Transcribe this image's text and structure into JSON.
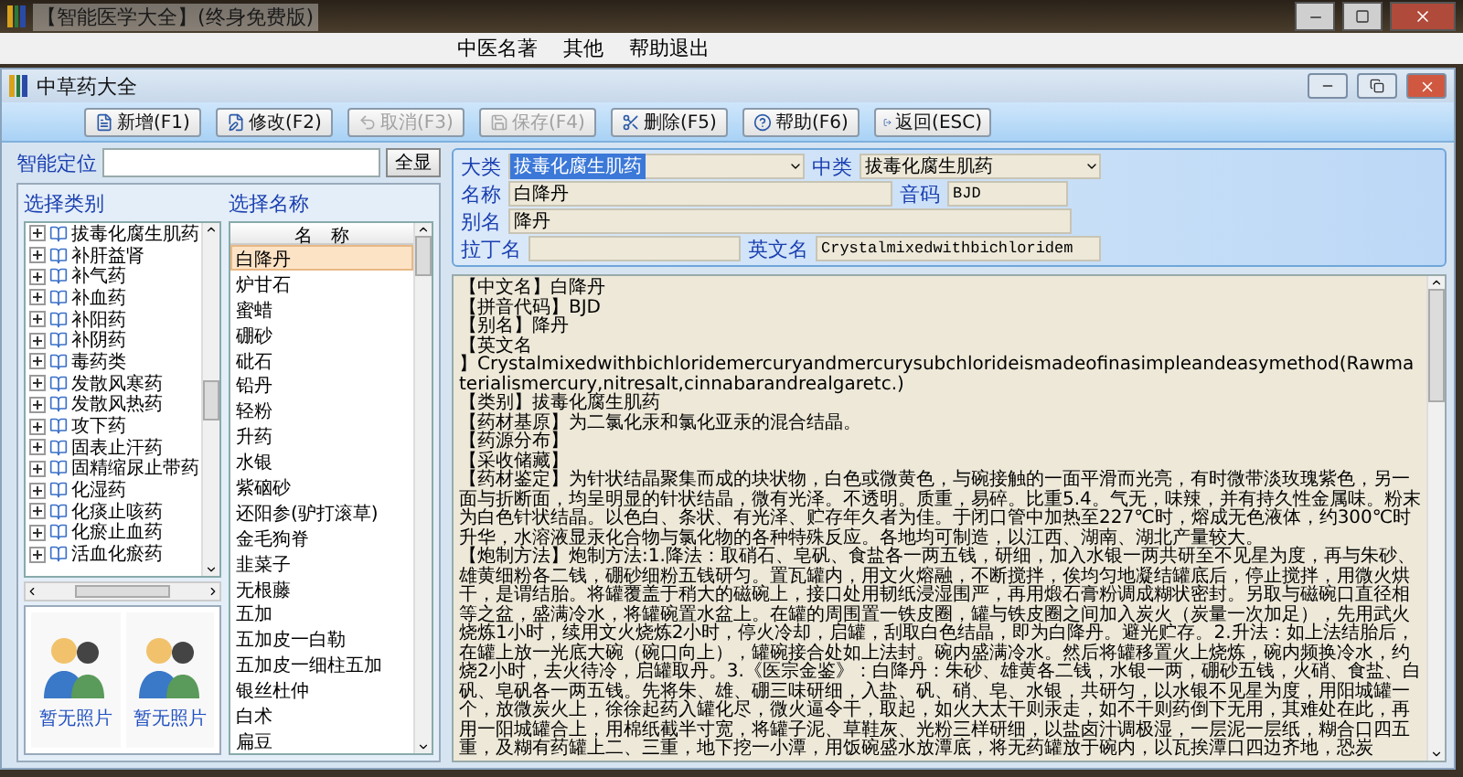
{
  "window": {
    "title": "【智能医学大全】(终身免费版)"
  },
  "menu": [
    "中医名著",
    "其他",
    "帮助退出"
  ],
  "child_window": {
    "title": "中草药大全"
  },
  "toolbar": [
    {
      "kind": "new",
      "label": "新增(F1)",
      "disabled": false
    },
    {
      "kind": "edit",
      "label": "修改(F2)",
      "disabled": false
    },
    {
      "kind": "cancel",
      "label": "取消(F3)",
      "disabled": true
    },
    {
      "kind": "save",
      "label": "保存(F4)",
      "disabled": true
    },
    {
      "kind": "delete",
      "label": "删除(F5)",
      "disabled": false
    },
    {
      "kind": "help",
      "label": "帮助(F6)",
      "disabled": false
    },
    {
      "kind": "back",
      "label": "返回(ESC)",
      "disabled": false
    }
  ],
  "search": {
    "label": "智能定位",
    "button": "全显"
  },
  "categories": {
    "label": "选择类别",
    "items": [
      {
        "text": "拔毒化腐生肌药",
        "expanded": false
      },
      {
        "text": "补肝益肾",
        "expanded": false
      },
      {
        "text": "补气药",
        "expanded": false
      },
      {
        "text": "补血药",
        "expanded": false
      },
      {
        "text": "补阳药",
        "expanded": false
      },
      {
        "text": "补阴药",
        "expanded": false
      },
      {
        "text": "毒药类",
        "expanded": false
      },
      {
        "text": "发散风寒药",
        "expanded": false
      },
      {
        "text": "发散风热药",
        "expanded": false
      },
      {
        "text": "攻下药",
        "expanded": false
      },
      {
        "text": "固表止汗药",
        "expanded": false
      },
      {
        "text": "固精缩尿止带药",
        "expanded": false
      },
      {
        "text": "化湿药",
        "expanded": false
      },
      {
        "text": "化痰止咳药",
        "expanded": false
      },
      {
        "text": "化瘀止血药",
        "expanded": false
      },
      {
        "text": "活血化瘀药",
        "expanded": false
      }
    ]
  },
  "names": {
    "label": "选择名称",
    "column": "名　称",
    "items": [
      {
        "text": "白降丹",
        "selected": true
      },
      {
        "text": "炉甘石",
        "selected": false
      },
      {
        "text": "蜜蜡",
        "selected": false
      },
      {
        "text": "硼砂",
        "selected": false
      },
      {
        "text": "砒石",
        "selected": false
      },
      {
        "text": "铅丹",
        "selected": false
      },
      {
        "text": "轻粉",
        "selected": false
      },
      {
        "text": "升药",
        "selected": false
      },
      {
        "text": "水银",
        "selected": false
      },
      {
        "text": "紫硇砂",
        "selected": false
      },
      {
        "text": "还阳参(驴打滚草)",
        "selected": false
      },
      {
        "text": "金毛狗脊",
        "selected": false
      },
      {
        "text": "韭菜子",
        "selected": false
      },
      {
        "text": "无根藤",
        "selected": false
      },
      {
        "text": "五加",
        "selected": false
      },
      {
        "text": "五加皮一白勒",
        "selected": false
      },
      {
        "text": "五加皮一细柱五加",
        "selected": false
      },
      {
        "text": "银丝杜仲",
        "selected": false
      },
      {
        "text": "白术",
        "selected": false
      },
      {
        "text": "扁豆",
        "selected": false
      }
    ]
  },
  "photos": [
    {
      "caption": "暂无照片"
    },
    {
      "caption": "暂无照片"
    }
  ],
  "form": {
    "major_class": {
      "label": "大类",
      "value": "拔毒化腐生肌药"
    },
    "mid_class": {
      "label": "中类",
      "value": "拔毒化腐生肌药"
    },
    "name": {
      "label": "名称",
      "value": "白降丹"
    },
    "code": {
      "label": "音码",
      "value": "BJD"
    },
    "alias": {
      "label": "别名",
      "value": "降丹"
    },
    "latin_name": {
      "label": "拉丁名"
    },
    "english_name": {
      "label": "英文名",
      "value": "Crystalmixedwithbichloridem"
    }
  },
  "details": [
    "【中文名】白降丹",
    "【拼音代码】BJD",
    "【别名】降丹",
    "【英文名",
    "】Crystalmixedwithbichloridemercuryandmercurysubchlorideismadeofinasimpleandeasymethod(Rawmaterialismercury,nitresalt,cinnabarandrealgaretc.)",
    "【类别】拔毒化腐生肌药",
    "【药材基原】为二氯化汞和氯化亚汞的混合结晶。",
    "【药源分布】",
    "【采收储藏】",
    "【药材鉴定】为针状结晶聚集而成的块状物，白色或微黄色，与碗接触的一面平滑而光亮，有时微带淡玫瑰紫色，另一面与折断面，均呈明显的针状结晶，微有光泽。不透明。质重，易碎。比重5.4。气无，味辣，并有持久性金属味。粉末为白色针状结晶。以色白、条状、有光泽、贮存年久者为佳。于闭口管中加热至227℃时，熔成无色液体，约300℃时升华，水溶液显汞化合物与氯化物的各种特殊反应。各地均可制造，以江西、湖南、湖北产量较大。",
    "【炮制方法】炮制方法:1.降法：取硝石、皂矾、食盐各一两五钱，研细，加入水银一两共研至不见星为度，再与朱砂、雄黄细粉各二钱，硼砂细粉五钱研匀。置瓦罐内，用文火熔融，不断搅拌，俟均匀地凝结罐底后，停止搅拌，用微火烘干，是谓结胎。将罐覆盖于稍大的磁碗上，接口处用韧纸浸湿围严，再用煅石膏粉调成糊状密封。另取与磁碗口直径相等之盆，盛满冷水，将罐碗置水盆上。在罐的周围置一铁皮圈，罐与铁皮圈之间加入炭火（炭量一次加足），先用武火烧炼1小时，续用文火烧炼2小时，停火冷却，启罐，刮取白色结晶，即为白降丹。避光贮存。2.升法：如上法结胎后，在罐上放一光底大碗（碗口向上），罐碗接合处如上法封。碗内盛满冷水。然后将罐移置火上烧炼，碗内频换冷水，约烧2小时，去火待冷，启罐取丹。3.《医宗金鉴》：白降丹：朱砂、雄黄各二钱，水银一两，硼砂五钱，火硝、食盐、白矾、皂矾各一两五钱。先将朱、雄、硼三味研细，入盐、矾、硝、皂、水银，共研匀，以水银不见星为度，用阳城罐一个，放微炭火上，徐徐起药入罐化尽，微火逼令干，取起，如火大太干则汞走，如不干则药倒下无用，其难处在此，再用一阳城罐合上，用棉纸截半寸宽，将罐子泥、草鞋灰、光粉三样研细，以盐卤汁调极湿，一层泥一层纸，糊合口四五重，及糊有药罐上二、三重，地下挖一小潭，用饭碗盛水放潭底，将无药罐放于碗内，以瓦挨潭口四边齐地，恐炭"
  ]
}
